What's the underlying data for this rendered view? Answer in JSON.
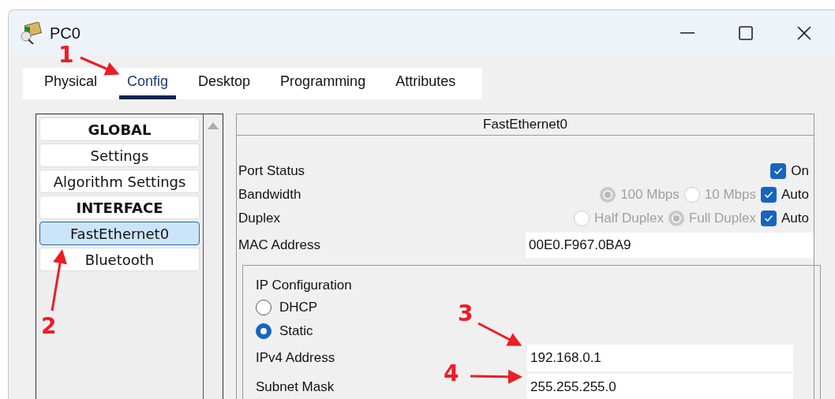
{
  "window": {
    "title": "PC0"
  },
  "tabs": [
    {
      "label": "Physical",
      "selected": false
    },
    {
      "label": "Config",
      "selected": true
    },
    {
      "label": "Desktop",
      "selected": false
    },
    {
      "label": "Programming",
      "selected": false
    },
    {
      "label": "Attributes",
      "selected": false
    }
  ],
  "sidebar": {
    "items": [
      {
        "label": "GLOBAL",
        "kind": "header",
        "selected": false
      },
      {
        "label": "Settings",
        "kind": "item",
        "selected": false
      },
      {
        "label": "Algorithm Settings",
        "kind": "item",
        "selected": false
      },
      {
        "label": "INTERFACE",
        "kind": "header",
        "selected": false
      },
      {
        "label": "FastEthernet0",
        "kind": "item",
        "selected": true
      },
      {
        "label": "Bluetooth",
        "kind": "item",
        "selected": false
      }
    ]
  },
  "interface_panel": {
    "title": "FastEthernet0",
    "rows": [
      {
        "label": "Port Status",
        "options": [
          {
            "kind": "checkbox",
            "label": "On",
            "checked": true,
            "disabled": false
          }
        ]
      },
      {
        "label": "Bandwidth",
        "options": [
          {
            "kind": "radio",
            "label": "100 Mbps",
            "selected": true,
            "disabled": true
          },
          {
            "kind": "radio",
            "label": "10 Mbps",
            "selected": false,
            "disabled": true
          },
          {
            "kind": "checkbox",
            "label": "Auto",
            "checked": true,
            "disabled": false
          }
        ]
      },
      {
        "label": "Duplex",
        "options": [
          {
            "kind": "radio",
            "label": "Half Duplex",
            "selected": false,
            "disabled": true
          },
          {
            "kind": "radio",
            "label": "Full Duplex",
            "selected": true,
            "disabled": true
          },
          {
            "kind": "checkbox",
            "label": "Auto",
            "checked": true,
            "disabled": false
          }
        ]
      }
    ],
    "mac_address": {
      "label": "MAC Address",
      "value": "00E0.F967.0BA9"
    },
    "ip_configuration": {
      "title": "IP Configuration",
      "modes": [
        {
          "label": "DHCP",
          "selected": false
        },
        {
          "label": "Static",
          "selected": true
        }
      ],
      "fields": [
        {
          "label": "IPv4 Address",
          "value": "192.168.0.1"
        },
        {
          "label": "Subnet Mask",
          "value": "255.255.255.0"
        }
      ]
    }
  },
  "annotations": [
    {
      "label": "1"
    },
    {
      "label": "2"
    },
    {
      "label": "3"
    },
    {
      "label": "4"
    }
  ]
}
